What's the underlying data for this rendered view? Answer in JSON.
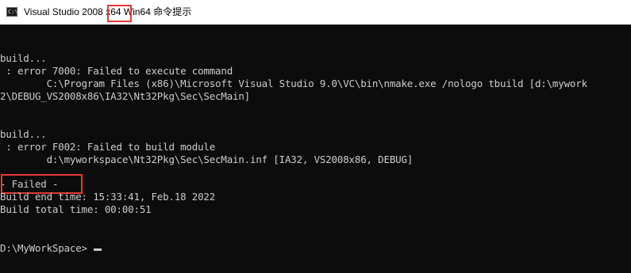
{
  "window": {
    "title": "Visual Studio 2008 x64 Win64 命令提示",
    "icon": "cmd-icon"
  },
  "console": {
    "lines": [
      "build...",
      " : error 7000: Failed to execute command",
      "        C:\\Program Files (x86)\\Microsoft Visual Studio 9.0\\VC\\bin\\nmake.exe /nologo tbuild [d:\\mywork",
      "2\\DEBUG_VS2008x86\\IA32\\Nt32Pkg\\Sec\\SecMain]",
      "build...",
      " : error F002: Failed to build module",
      "        d:\\myworkspace\\Nt32Pkg\\Sec\\SecMain.inf [IA32, VS2008x86, DEBUG]",
      "- Failed -",
      "Build end time: 15:33:41, Feb.18 2022",
      "Build total time: 00:00:51",
      "D:\\MyWorkSpace>"
    ]
  },
  "colors": {
    "background": "#0c0c0c",
    "text": "#cccccc",
    "highlight": "#e53935"
  }
}
